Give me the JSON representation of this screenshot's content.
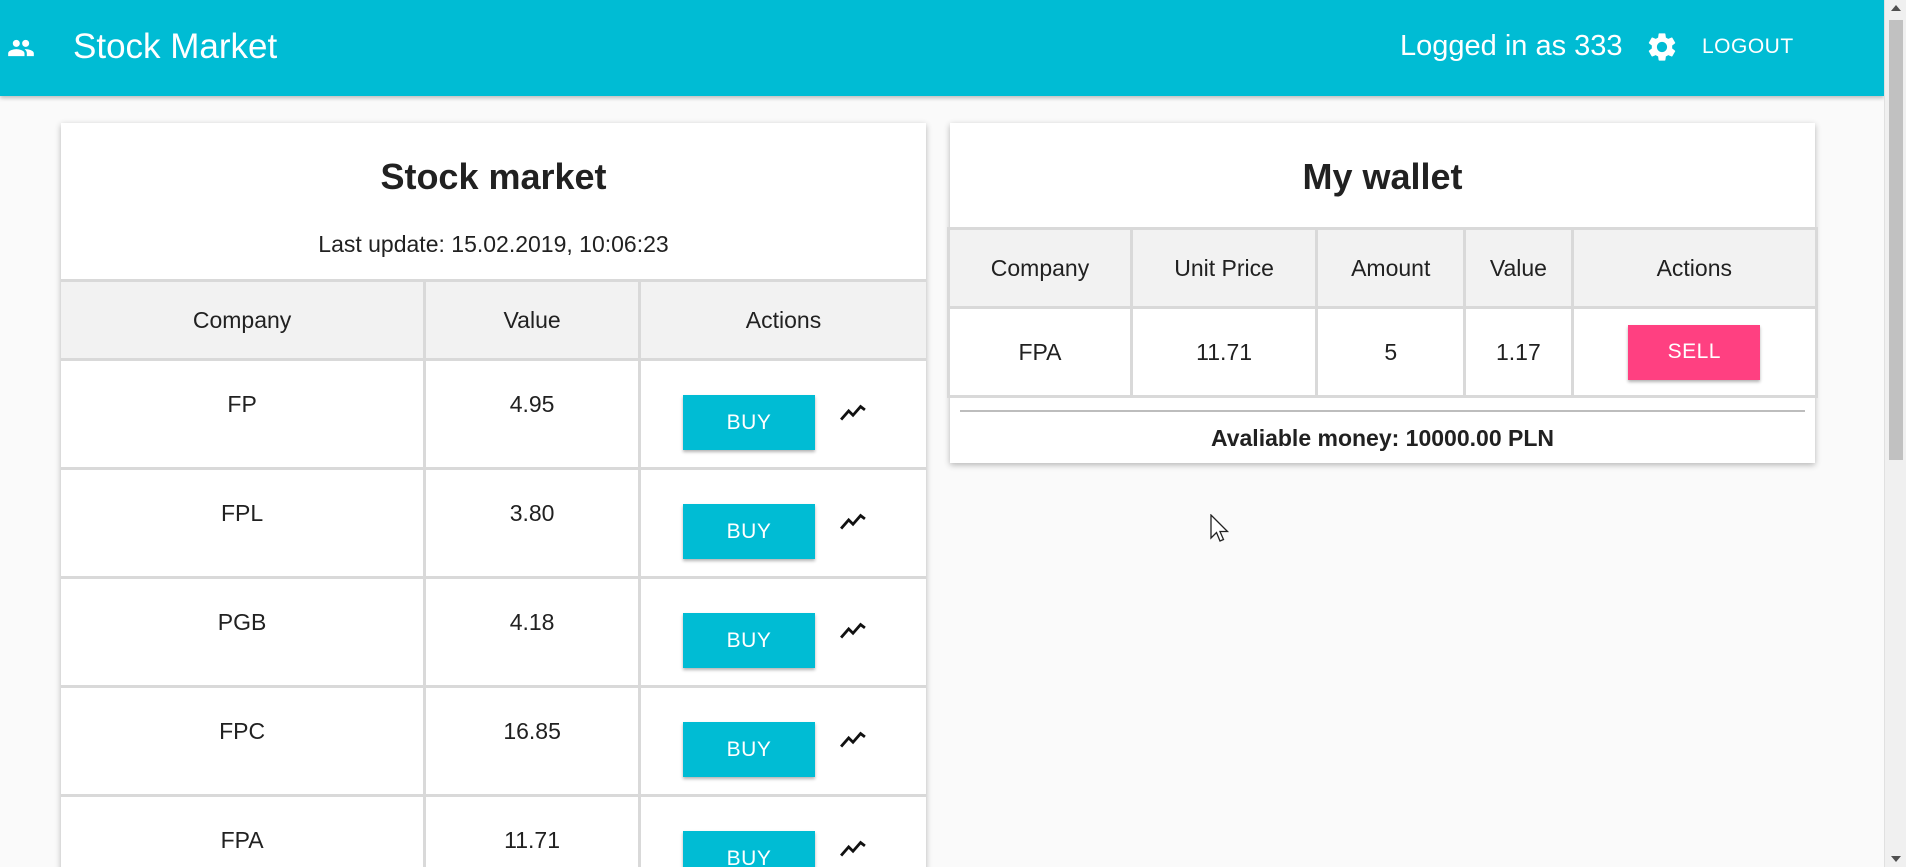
{
  "toolbar": {
    "title": "Stock Market",
    "user_label": "Logged in as 333",
    "logout_label": "LOGOUT",
    "accent_color": "#00bcd4",
    "menu_icon": "people-icon",
    "settings_icon": "gear-icon"
  },
  "market": {
    "title": "Stock market",
    "last_update": "Last update: 15.02.2019, 10:06:23",
    "headers": [
      "Company",
      "Value",
      "Actions"
    ],
    "buy_label": "BUY",
    "trend_icon": "trending-up-icon",
    "rows": [
      {
        "company": "FP",
        "value": "4.95"
      },
      {
        "company": "FPL",
        "value": "3.80"
      },
      {
        "company": "PGB",
        "value": "4.18"
      },
      {
        "company": "FPC",
        "value": "16.85"
      },
      {
        "company": "FPA",
        "value": "11.71"
      }
    ]
  },
  "wallet": {
    "title": "My wallet",
    "headers": [
      "Company",
      "Unit Price",
      "Amount",
      "Value",
      "Actions"
    ],
    "sell_label": "SELL",
    "sell_color": "#ff4081",
    "rows": [
      {
        "company": "FPA",
        "unit_price": "11.71",
        "amount": "5",
        "value": "1.17"
      }
    ],
    "available_money": "Avaliable money: 10000.00 PLN"
  }
}
